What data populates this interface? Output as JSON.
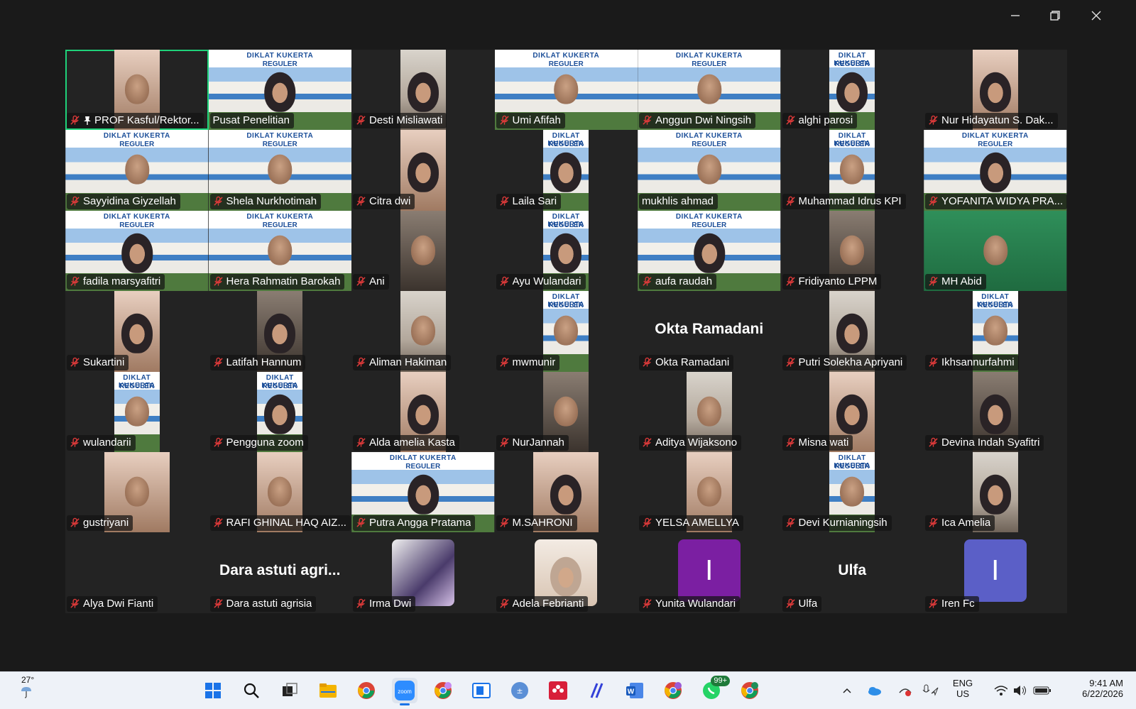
{
  "window": {
    "controls": [
      "minimize-icon",
      "restore-icon",
      "close-icon"
    ]
  },
  "colors": {
    "active_speaker": "#1fd27a",
    "muted_mic": "#e03a3a",
    "avatar_purple": "#7b1fa2",
    "avatar_indigo": "#5b5fc7"
  },
  "participants": [
    {
      "name": "PROF Kasful/Rektor...",
      "view": "video",
      "style": "plain",
      "pinned": true,
      "active": true
    },
    {
      "name": "Pusat Penelitian",
      "view": "video",
      "style": "banner",
      "unmuted": true
    },
    {
      "name": "Desti Misliawati",
      "view": "video",
      "style": "narrow"
    },
    {
      "name": "Umi Afifah",
      "view": "video",
      "style": "banner"
    },
    {
      "name": "Anggun Dwi Ningsih",
      "view": "video",
      "style": "banner"
    },
    {
      "name": "alghi parosi",
      "view": "video",
      "style": "narrow-banner"
    },
    {
      "name": "Nur Hidayatun S. Dak...",
      "view": "video",
      "style": "narrow"
    },
    {
      "name": "Sayyidina Giyzellah",
      "view": "video",
      "style": "banner"
    },
    {
      "name": "Shela Nurkhotimah",
      "view": "video",
      "style": "banner"
    },
    {
      "name": "Citra dwi",
      "view": "video",
      "style": "narrow"
    },
    {
      "name": "Laila Sari",
      "view": "video",
      "style": "narrow-banner"
    },
    {
      "name": "mukhlis ahmad",
      "view": "video",
      "style": "banner",
      "unmuted": true
    },
    {
      "name": "Muhammad Idrus KPI",
      "view": "video",
      "style": "narrow-banner"
    },
    {
      "name": "YOFANITA WIDYA PRA...",
      "view": "video",
      "style": "banner"
    },
    {
      "name": "fadila marsyafitri",
      "view": "video",
      "style": "banner"
    },
    {
      "name": "Hera Rahmatin Barokah",
      "view": "video",
      "style": "banner"
    },
    {
      "name": "Ani",
      "view": "video",
      "style": "narrow"
    },
    {
      "name": "Ayu Wulandari",
      "view": "video",
      "style": "narrow-banner"
    },
    {
      "name": "aufa raudah",
      "view": "video",
      "style": "banner"
    },
    {
      "name": "Fridiyanto LPPM",
      "view": "video",
      "style": "narrow"
    },
    {
      "name": "MH Abid",
      "view": "video",
      "style": "green"
    },
    {
      "name": "Sukartini",
      "view": "video",
      "style": "narrow"
    },
    {
      "name": "Latifah Hannum",
      "view": "video",
      "style": "narrow"
    },
    {
      "name": "Aliman Hakiman",
      "view": "video",
      "style": "narrow"
    },
    {
      "name": "mwmunir",
      "view": "video",
      "style": "narrow-banner"
    },
    {
      "name": "Okta Ramadani",
      "view": "name",
      "display": "Okta Ramadani"
    },
    {
      "name": "Putri Solekha Apriyani",
      "view": "video",
      "style": "narrow"
    },
    {
      "name": "Ikhsannurfahmi",
      "view": "video",
      "style": "narrow-banner"
    },
    {
      "name": "wulandarii",
      "view": "video",
      "style": "narrow-banner"
    },
    {
      "name": "Pengguna zoom",
      "view": "video",
      "style": "narrow-banner"
    },
    {
      "name": "Alda amelia Kasta",
      "view": "video",
      "style": "narrow"
    },
    {
      "name": "NurJannah",
      "view": "video",
      "style": "narrow"
    },
    {
      "name": "Aditya Wijaksono",
      "view": "video",
      "style": "narrow"
    },
    {
      "name": "Misna wati",
      "view": "video",
      "style": "narrow"
    },
    {
      "name": "Devina Indah Syafitri",
      "view": "video",
      "style": "narrow"
    },
    {
      "name": "gustriyani",
      "view": "video",
      "style": "mid"
    },
    {
      "name": "RAFI GHINAL HAQ AIZ...",
      "view": "video",
      "style": "narrow"
    },
    {
      "name": "Putra Angga Pratama",
      "view": "video",
      "style": "banner"
    },
    {
      "name": "M.SAHRONI",
      "view": "video",
      "style": "mid"
    },
    {
      "name": "YELSA AMELLYA",
      "view": "video",
      "style": "narrow"
    },
    {
      "name": "Devi Kurnianingsih",
      "view": "video",
      "style": "narrow-banner"
    },
    {
      "name": "Ica Amelia",
      "view": "video",
      "style": "narrow"
    },
    {
      "name": "Alya Dwi Fianti",
      "view": "blank"
    },
    {
      "name": "Dara astuti agrisia",
      "view": "name",
      "display": "Dara astuti agri..."
    },
    {
      "name": "Irma Dwi",
      "view": "photo"
    },
    {
      "name": "Adela Febrianti",
      "view": "cat"
    },
    {
      "name": "Yunita Wulandari",
      "view": "avatar",
      "initial": "I",
      "color": "#7b1fa2"
    },
    {
      "name": "Ulfa",
      "view": "name",
      "display": "Ulfa"
    },
    {
      "name": "Iren Fc",
      "view": "avatar",
      "initial": "I",
      "color": "#5b5fc7"
    }
  ],
  "taskbar": {
    "weather": {
      "temp": "27°"
    },
    "apps": [
      {
        "name": "windows-start-icon"
      },
      {
        "name": "search-icon"
      },
      {
        "name": "task-view-icon"
      },
      {
        "name": "file-explorer-icon"
      },
      {
        "name": "chrome-icon"
      },
      {
        "name": "zoom-icon",
        "label": "zoom",
        "active": true
      },
      {
        "name": "chrome-profile-icon"
      },
      {
        "name": "whiteboard-icon"
      },
      {
        "name": "calculator-icon"
      },
      {
        "name": "mendeley-icon"
      },
      {
        "name": "pen-app-icon"
      },
      {
        "name": "word-icon"
      },
      {
        "name": "chrome-profile-p-icon"
      },
      {
        "name": "whatsapp-icon",
        "badge": "99+"
      },
      {
        "name": "chrome-profile-p2-icon"
      }
    ],
    "tray": {
      "lang": "ENG",
      "region": "US",
      "time": "9:41 AM",
      "date": "6/22/2026"
    }
  }
}
